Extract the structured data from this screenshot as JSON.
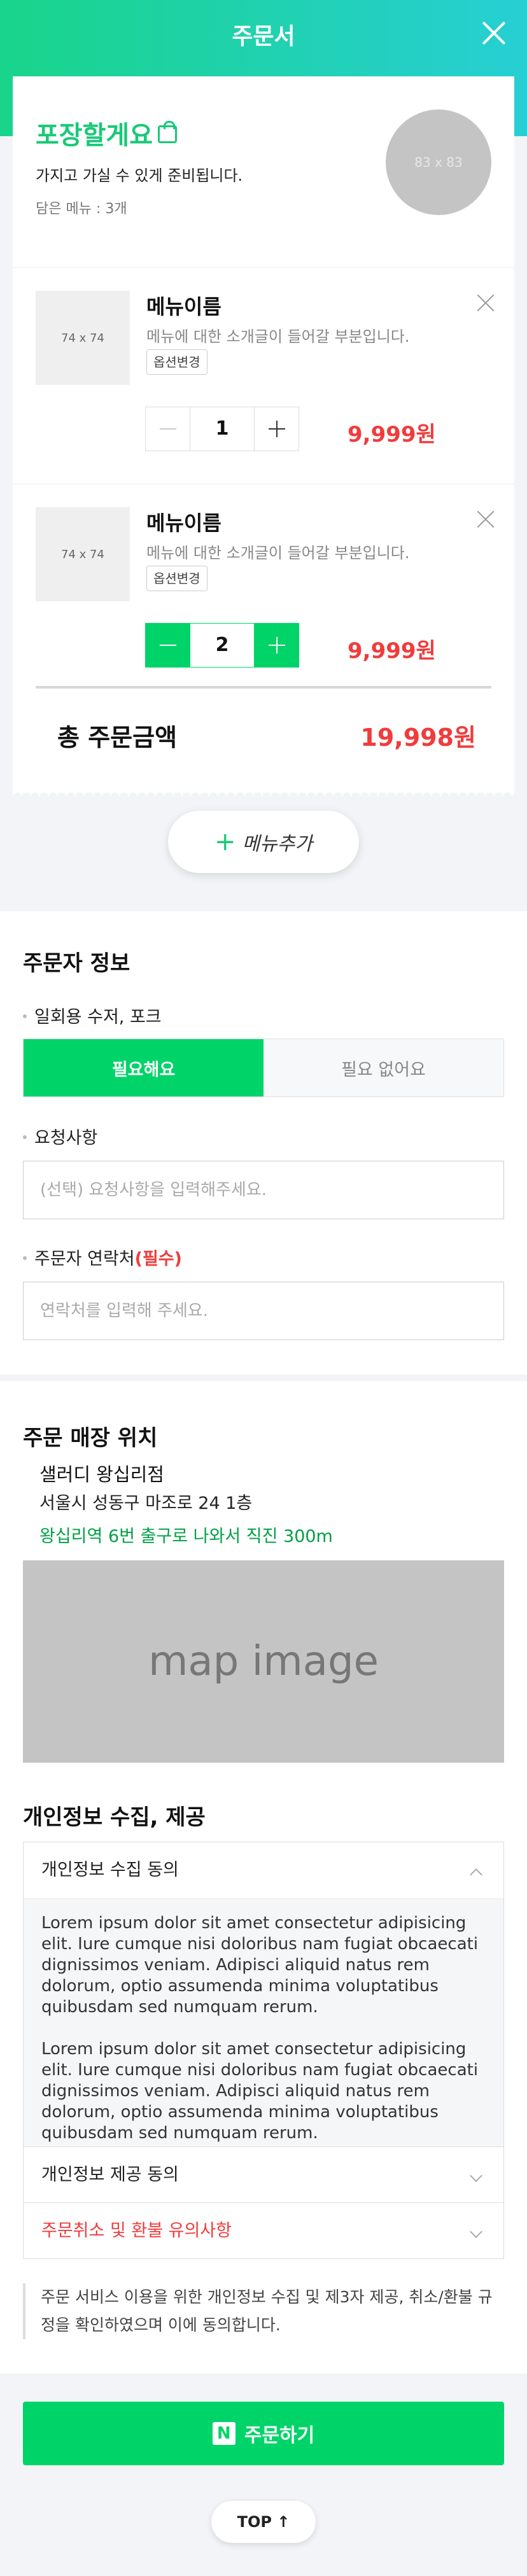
{
  "header": {
    "title": "주문서"
  },
  "pickup": {
    "title": "포장할게요",
    "desc": "가지고 가실 수 있게 준비됩니다.",
    "count": "담은 메뉴 : 3개",
    "thumb_label": "83 x 83"
  },
  "items": [
    {
      "thumb_label": "74 x 74",
      "name": "메뉴이름",
      "desc": "메뉴에 대한 소개글이 들어갈 부분입니다.",
      "option_label": "옵션변경",
      "qty": "1",
      "price": "9,999원"
    },
    {
      "thumb_label": "74 x 74",
      "name": "메뉴이름",
      "desc": "메뉴에 대한 소개글이 들어갈 부분입니다.",
      "option_label": "옵션변경",
      "qty": "2",
      "price": "9,999원"
    }
  ],
  "total": {
    "label": "총 주문금액",
    "value": "19,998원"
  },
  "add_menu": {
    "label": "메뉴추가"
  },
  "orderer": {
    "title": "주문자 정보",
    "utensils_label": "일회용 수저, 포크",
    "utensils_options": [
      "필요해요",
      "필요 없어요"
    ],
    "request_label": "요청사항",
    "request_placeholder": "(선택) 요청사항을 입력해주세요.",
    "contact_label": "주문자 연락처",
    "contact_required": "(필수)",
    "contact_placeholder": "연락처를 입력해 주세요."
  },
  "store": {
    "title": "주문 매장 위치",
    "name": "샐러디 왕십리점",
    "address": "서울시 성동구 마조로 24 1층",
    "directions": "왕십리역 6번 출구로 나와서 직진 300m",
    "map_label": "map image"
  },
  "privacy": {
    "title": "개인정보 수집, 제공",
    "sections": [
      {
        "label": "개인정보 수집 동의"
      },
      {
        "label": "개인정보 제공 동의"
      },
      {
        "label": "주문취소 및 환불 유의사항"
      }
    ],
    "body": [
      "Lorem ipsum dolor sit amet consectetur adipisicing elit. Iure cumque nisi doloribus nam fugiat obcaecati dignissimos veniam. Adipisci aliquid natus rem dolorum, optio assumenda minima voluptatibus quibusdam sed numquam rerum.",
      "Lorem ipsum dolor sit amet consectetur adipisicing elit. Iure cumque nisi doloribus nam fugiat obcaecati dignissimos veniam. Adipisci aliquid natus rem dolorum, optio assumenda minima voluptatibus quibusdam sed numquam rerum."
    ],
    "notice": "주문 서비스 이용을 위한 개인정보 수집 및 제3자 제공, 취소/환불 규정을 확인하였으며 이에 동의합니다."
  },
  "order_button": {
    "icon": "N",
    "label": "주문하기"
  },
  "top_button": {
    "label": "TOP ↑"
  }
}
